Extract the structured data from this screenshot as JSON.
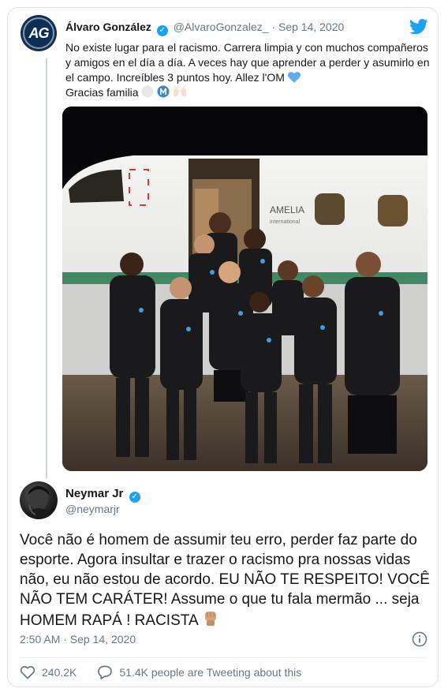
{
  "quoted_tweet": {
    "avatar_text": "AG",
    "author_name": "Álvaro González",
    "author_handle": "@AlvaroGonzalez_",
    "separator": "·",
    "date": "Sep 14, 2020",
    "text_main": "No existe lugar para el racismo. Carrera limpia y con muchos compañeros y amigos en el día a día. A veces hay que aprender a perder y asumirlo en el campo. Increíbles 3 puntos hoy. Allez l'OM",
    "text_line2": "Gracias familia",
    "photo_aircraft_text": "AMELIA",
    "photo_aircraft_subtext": "international"
  },
  "tweet": {
    "author_name": "Neymar Jr",
    "author_handle": "@neymarjr",
    "text": "Você não é homem de assumir teu erro, perder faz parte do esporte. Agora insultar e trazer o racismo pra nossas vidas não, eu não estou de acordo. EU NÃO TE RESPEITO! VOCÊ NÃO TEM CARÁTER! Assume o que tu fala mermão ... seja HOMEM RAPÁ ! RACISTA",
    "timestamp": "2:50 AM · Sep 14, 2020",
    "likes": "240.2K",
    "retweets_text": "51.4K people are Tweeting about this"
  },
  "icons": {
    "brand": "twitter-bird-icon",
    "verified": "verified-badge-icon",
    "like": "heart-icon",
    "comment": "speech-bubble-icon",
    "info": "info-icon"
  },
  "colors": {
    "brand_blue": "#1da1f2",
    "text": "#14171a",
    "muted": "#657786",
    "border": "#dbe3e8"
  }
}
